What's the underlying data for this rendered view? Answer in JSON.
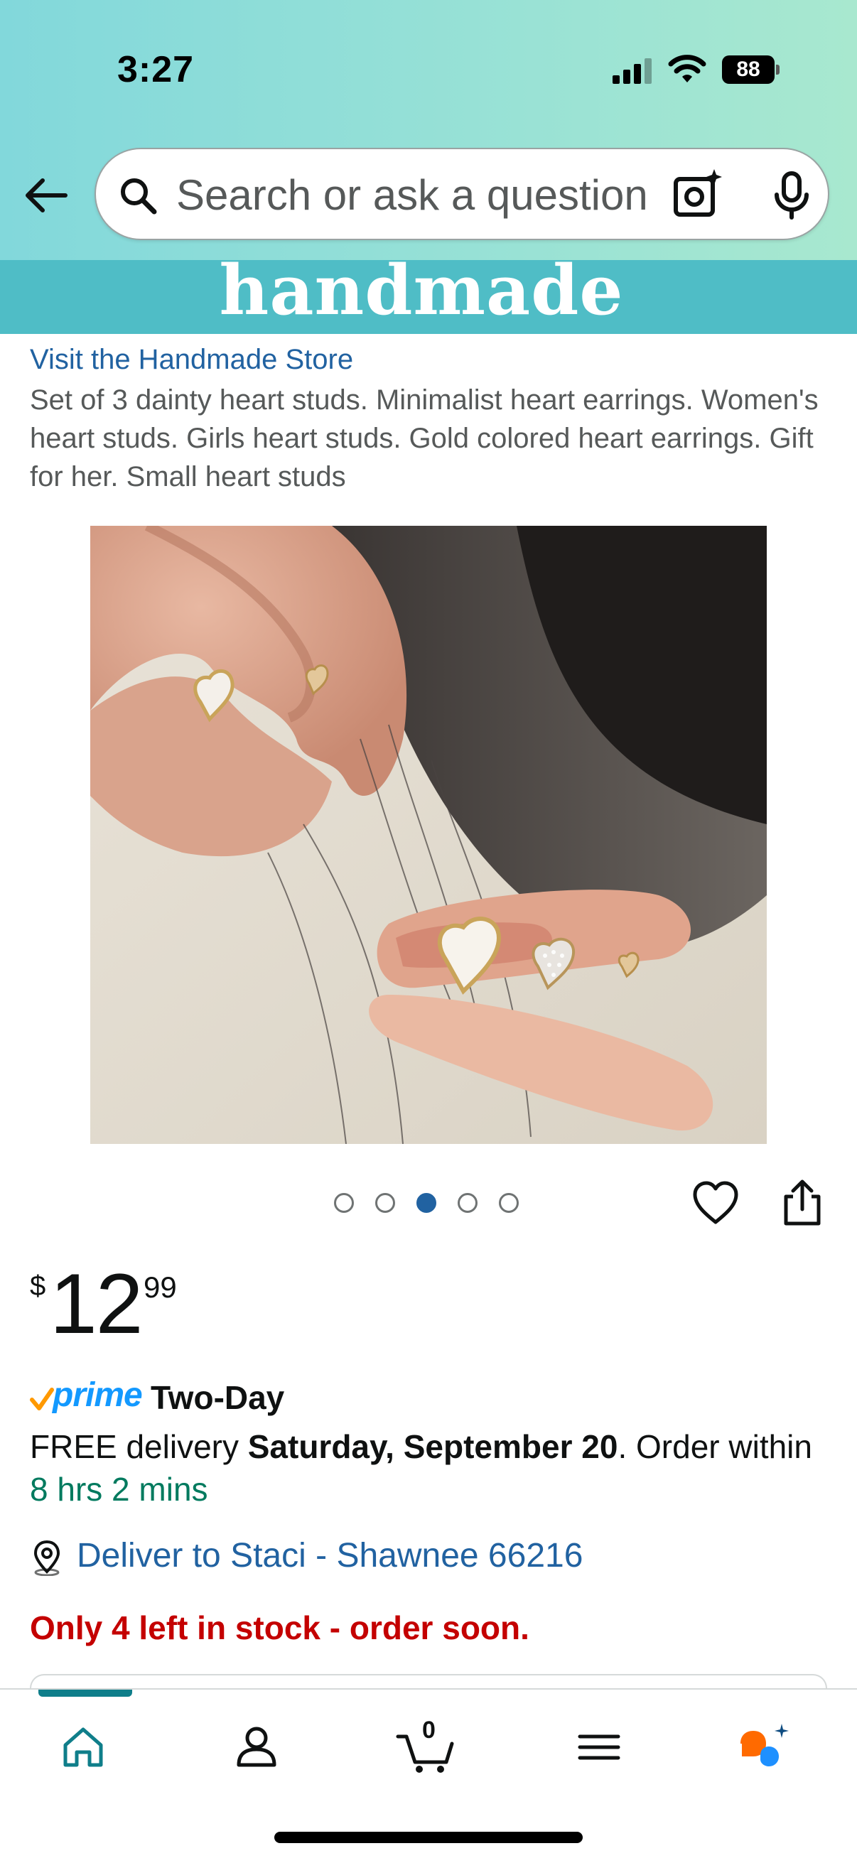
{
  "status_bar": {
    "time": "3:27",
    "battery": "88"
  },
  "search": {
    "placeholder": "Search or ask a question"
  },
  "banner": {
    "text": "handmade"
  },
  "product": {
    "store_link": "Visit the Handmade Store",
    "title": "Set of 3 dainty heart studs. Minimalist heart earrings. Women's heart studs. Girls heart studs. Gold colored heart earrings. Gift for her. Small heart studs",
    "image_count": 5,
    "active_image_index": 2
  },
  "price": {
    "currency": "$",
    "whole": "12",
    "fraction": "99"
  },
  "prime": {
    "label": "prime",
    "type": "Two-Day"
  },
  "delivery": {
    "prefix": "FREE delivery ",
    "date": "Saturday, September 20",
    "middle": ". Order within ",
    "countdown": "8 hrs 2 mins"
  },
  "location": {
    "text": "Deliver to Staci - Shawnee 66216"
  },
  "stock": {
    "text": "Only 4 left in stock - order soon."
  },
  "bottom_nav": {
    "items": [
      "home",
      "account",
      "cart",
      "menu",
      "rufus"
    ],
    "cart_count": "0",
    "active": "home"
  },
  "colors": {
    "link": "#2162a1",
    "stock_warning": "#c40000",
    "countdown": "#007a5e",
    "prime_blue": "#1399ff",
    "banner": "#4fbdc6"
  }
}
